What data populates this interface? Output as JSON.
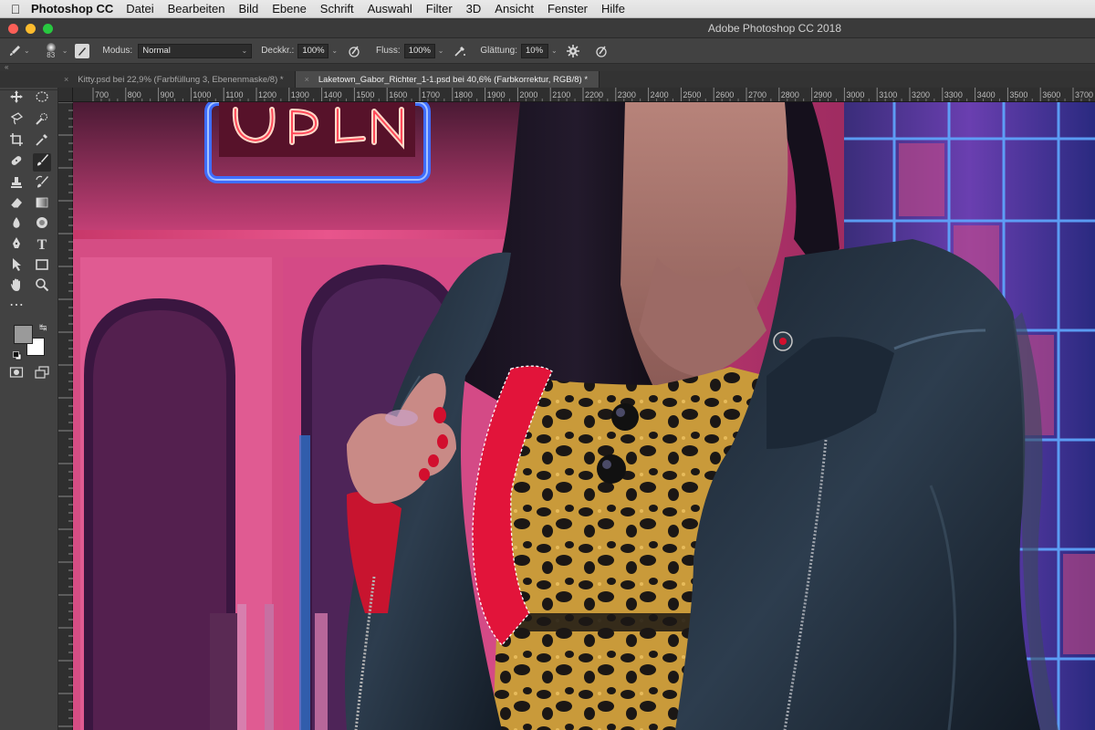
{
  "menubar": {
    "apple_icon": "apple-icon",
    "app_name": "Photoshop CC",
    "items": [
      "Datei",
      "Bearbeiten",
      "Bild",
      "Ebene",
      "Schrift",
      "Auswahl",
      "Filter",
      "3D",
      "Ansicht",
      "Fenster",
      "Hilfe"
    ]
  },
  "window": {
    "title": "Adobe Photoshop CC 2018"
  },
  "options": {
    "brush_size": "83",
    "mode_label": "Modus:",
    "mode_value": "Normal",
    "opacity_label": "Deckkr.:",
    "opacity_value": "100%",
    "flow_label": "Fluss:",
    "flow_value": "100%",
    "smoothing_label": "Glättung:",
    "smoothing_value": "10%"
  },
  "collapse_glyph": "«",
  "tabs": [
    {
      "label": "Kitty.psd bei 22,9% (Farbfüllung 3, Ebenenmaske/8) *",
      "active": false
    },
    {
      "label": "Laketown_Gabor_Richter_1-1.psd bei 40,6% (Farbkorrektur, RGB/8) *",
      "active": true
    }
  ],
  "tab_close": "×",
  "ruler_top_labels": [
    "700",
    "800",
    "900",
    "1000",
    "1100",
    "1200",
    "1300",
    "1400",
    "1500",
    "1600",
    "1700",
    "1800",
    "1900",
    "2000",
    "2100",
    "2200",
    "2300",
    "2400",
    "2500",
    "2600",
    "2700",
    "2800",
    "2900",
    "3000",
    "3100",
    "3200",
    "3300",
    "3400",
    "3500",
    "3600",
    "3700"
  ],
  "colors": {
    "foreground": "#9a9a9a",
    "background": "#ffffff",
    "accent_red": "#e2143a",
    "neon_pink": "#e2467a"
  }
}
